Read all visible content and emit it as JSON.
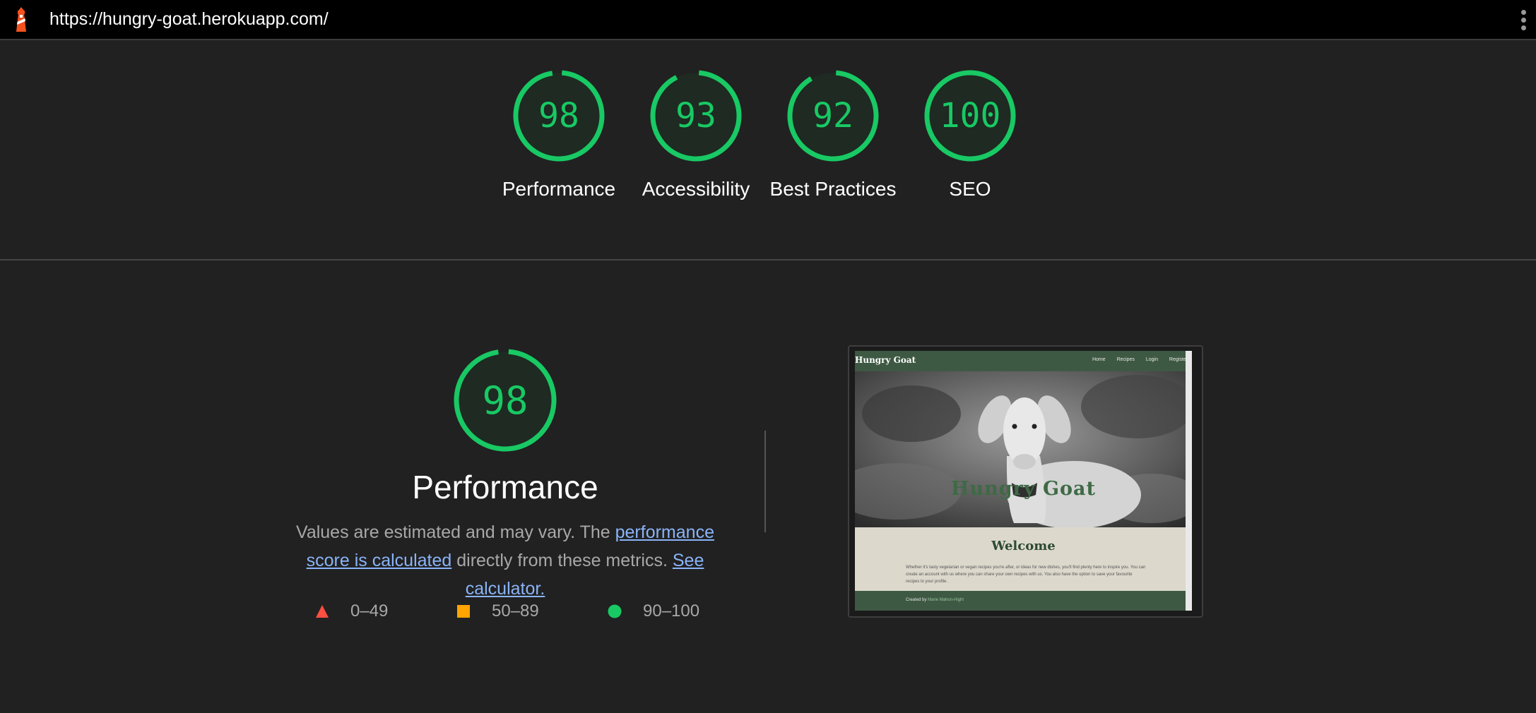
{
  "url": "https://hungry-goat.herokuapp.com/",
  "score_color": "#18c964",
  "categories": [
    {
      "score": 98,
      "label": "Performance"
    },
    {
      "score": 93,
      "label": "Accessibility"
    },
    {
      "score": 92,
      "label": "Best Practices"
    },
    {
      "score": 100,
      "label": "SEO"
    }
  ],
  "performance": {
    "score": 98,
    "title": "Performance",
    "desc_part1": "Values are estimated and may vary. The ",
    "desc_link1": "performance score is calculated",
    "desc_part2": " directly from these metrics. ",
    "desc_link2": "See calculator."
  },
  "legend": [
    {
      "range": "0–49",
      "shape": "triangle",
      "color": "#ff4e42"
    },
    {
      "range": "50–89",
      "shape": "square",
      "color": "#ffa400"
    },
    {
      "range": "90–100",
      "shape": "circle",
      "color": "#18c964"
    }
  ],
  "screenshot": {
    "brand": "Hungry Goat",
    "nav": [
      "Home",
      "Recipes",
      "Login",
      "Register"
    ],
    "hero_title": "Hungry Goat",
    "welcome": "Welcome",
    "body": "Whether it's tasty vegetarian or vegan recipes you're after, or ideas for new dishes, you'll find plenty here to inspire you. You can create an account with us where you can share your own recipes with us. You also have the option to save your favourite recipes to your profile.",
    "footer_prefix": "Created by",
    "footer_author": "Marie Mahon-Hight"
  }
}
